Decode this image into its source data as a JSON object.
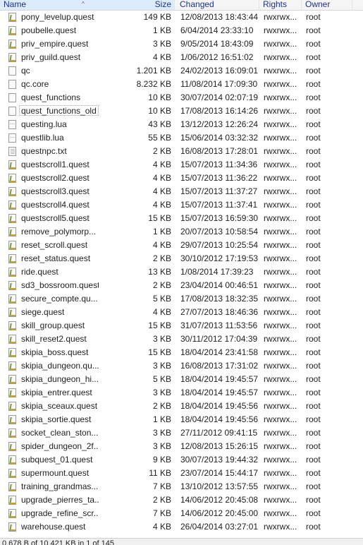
{
  "columns": {
    "name": "Name",
    "size": "Size",
    "changed": "Changed",
    "rights": "Rights",
    "owner": "Owner"
  },
  "files": [
    {
      "name": "pony_levelup.quest",
      "size": "149 KB",
      "changed": "12/08/2013 18:43:44",
      "rights": "rwxrwx...",
      "owner": "root",
      "icon": "quest"
    },
    {
      "name": "poubelle.quest",
      "size": "1 KB",
      "changed": "6/04/2014 23:33:10",
      "rights": "rwxrwx...",
      "owner": "root",
      "icon": "quest"
    },
    {
      "name": "priv_empire.quest",
      "size": "3 KB",
      "changed": "9/05/2014 18:43:09",
      "rights": "rwxrwx...",
      "owner": "root",
      "icon": "quest"
    },
    {
      "name": "priv_guild.quest",
      "size": "4 KB",
      "changed": "1/06/2012 16:51:02",
      "rights": "rwxrwx...",
      "owner": "root",
      "icon": "quest"
    },
    {
      "name": "qc",
      "size": "1.201 KB",
      "changed": "24/02/2013 16:09:01",
      "rights": "rwxrwx...",
      "owner": "root",
      "icon": "file"
    },
    {
      "name": "qc.core",
      "size": "8.232 KB",
      "changed": "11/08/2014 17:09:30",
      "rights": "rwxrwx...",
      "owner": "root",
      "icon": "file"
    },
    {
      "name": "quest_functions",
      "size": "10 KB",
      "changed": "30/07/2014 02:07:19",
      "rights": "rwxrwx...",
      "owner": "root",
      "icon": "file"
    },
    {
      "name": "quest_functions_old",
      "size": "10 KB",
      "changed": "17/08/2013 16:14:26",
      "rights": "rwxrwx...",
      "owner": "root",
      "icon": "file",
      "selected": true
    },
    {
      "name": "questing.lua",
      "size": "43 KB",
      "changed": "13/12/2013 12:26:24",
      "rights": "rwxrwx...",
      "owner": "root",
      "icon": "lua"
    },
    {
      "name": "questlib.lua",
      "size": "55 KB",
      "changed": "15/06/2014 03:32:32",
      "rights": "rwxrwx...",
      "owner": "root",
      "icon": "lua"
    },
    {
      "name": "questnpc.txt",
      "size": "2 KB",
      "changed": "16/08/2013 17:28:01",
      "rights": "rwxrwx...",
      "owner": "root",
      "icon": "txt"
    },
    {
      "name": "questscroll1.quest",
      "size": "4 KB",
      "changed": "15/07/2013 11:34:36",
      "rights": "rwxrwx...",
      "owner": "root",
      "icon": "quest"
    },
    {
      "name": "questscroll2.quest",
      "size": "4 KB",
      "changed": "15/07/2013 11:36:22",
      "rights": "rwxrwx...",
      "owner": "root",
      "icon": "quest"
    },
    {
      "name": "questscroll3.quest",
      "size": "4 KB",
      "changed": "15/07/2013 11:37:27",
      "rights": "rwxrwx...",
      "owner": "root",
      "icon": "quest"
    },
    {
      "name": "questscroll4.quest",
      "size": "4 KB",
      "changed": "15/07/2013 11:37:41",
      "rights": "rwxrwx...",
      "owner": "root",
      "icon": "quest"
    },
    {
      "name": "questscroll5.quest",
      "size": "15 KB",
      "changed": "15/07/2013 16:59:30",
      "rights": "rwxrwx...",
      "owner": "root",
      "icon": "quest"
    },
    {
      "name": "remove_polymorp...",
      "size": "1 KB",
      "changed": "20/07/2013 10:58:54",
      "rights": "rwxrwx...",
      "owner": "root",
      "icon": "quest"
    },
    {
      "name": "reset_scroll.quest",
      "size": "4 KB",
      "changed": "29/07/2013 10:25:54",
      "rights": "rwxrwx...",
      "owner": "root",
      "icon": "quest"
    },
    {
      "name": "reset_status.quest",
      "size": "2 KB",
      "changed": "30/10/2012 17:19:53",
      "rights": "rwxrwx...",
      "owner": "root",
      "icon": "quest"
    },
    {
      "name": "ride.quest",
      "size": "13 KB",
      "changed": "1/08/2014 17:39:23",
      "rights": "rwxrwx...",
      "owner": "root",
      "icon": "quest"
    },
    {
      "name": "sd3_bossroom.quest",
      "size": "2 KB",
      "changed": "23/04/2014 00:46:51",
      "rights": "rwxrwx...",
      "owner": "root",
      "icon": "quest"
    },
    {
      "name": "secure_compte.qu...",
      "size": "5 KB",
      "changed": "17/08/2013 18:32:35",
      "rights": "rwxrwx...",
      "owner": "root",
      "icon": "quest"
    },
    {
      "name": "siege.quest",
      "size": "4 KB",
      "changed": "27/07/2013 18:46:36",
      "rights": "rwxrwx...",
      "owner": "root",
      "icon": "quest"
    },
    {
      "name": "skill_group.quest",
      "size": "15 KB",
      "changed": "31/07/2013 11:53:56",
      "rights": "rwxrwx...",
      "owner": "root",
      "icon": "quest"
    },
    {
      "name": "skill_reset2.quest",
      "size": "3 KB",
      "changed": "30/11/2012 17:04:39",
      "rights": "rwxrwx...",
      "owner": "root",
      "icon": "quest"
    },
    {
      "name": "skipia_boss.quest",
      "size": "15 KB",
      "changed": "18/04/2014 23:41:58",
      "rights": "rwxrwx...",
      "owner": "root",
      "icon": "quest"
    },
    {
      "name": "skipia_dungeon.qu...",
      "size": "3 KB",
      "changed": "16/08/2013 17:31:02",
      "rights": "rwxrwx...",
      "owner": "root",
      "icon": "quest"
    },
    {
      "name": "skipia_dungeon_hi...",
      "size": "5 KB",
      "changed": "18/04/2014 19:45:57",
      "rights": "rwxrwx...",
      "owner": "root",
      "icon": "quest"
    },
    {
      "name": "skipia_entrer.quest",
      "size": "3 KB",
      "changed": "18/04/2014 19:45:57",
      "rights": "rwxrwx...",
      "owner": "root",
      "icon": "quest"
    },
    {
      "name": "skipia_sceaux.quest",
      "size": "2 KB",
      "changed": "18/04/2014 19:45:56",
      "rights": "rwxrwx...",
      "owner": "root",
      "icon": "quest"
    },
    {
      "name": "skipia_sortie.quest",
      "size": "1 KB",
      "changed": "18/04/2014 19:45:56",
      "rights": "rwxrwx...",
      "owner": "root",
      "icon": "quest"
    },
    {
      "name": "socket_clean_ston...",
      "size": "3 KB",
      "changed": "27/11/2012 09:41:15",
      "rights": "rwxrwx...",
      "owner": "root",
      "icon": "quest"
    },
    {
      "name": "spider_dungeon_2f...",
      "size": "3 KB",
      "changed": "12/08/2013 15:26:15",
      "rights": "rwxrwx...",
      "owner": "root",
      "icon": "quest"
    },
    {
      "name": "subquest_01.quest",
      "size": "9 KB",
      "changed": "30/07/2013 19:44:32",
      "rights": "rwxrwx...",
      "owner": "root",
      "icon": "quest"
    },
    {
      "name": "supermount.quest",
      "size": "11 KB",
      "changed": "23/07/2014 15:44:17",
      "rights": "rwxrwx...",
      "owner": "root",
      "icon": "quest"
    },
    {
      "name": "training_grandmas...",
      "size": "7 KB",
      "changed": "13/10/2012 13:57:55",
      "rights": "rwxrwx...",
      "owner": "root",
      "icon": "quest"
    },
    {
      "name": "upgrade_pierres_ta...",
      "size": "2 KB",
      "changed": "14/06/2012 20:45:08",
      "rights": "rwxrwx...",
      "owner": "root",
      "icon": "quest"
    },
    {
      "name": "upgrade_refine_scr...",
      "size": "7 KB",
      "changed": "14/06/2012 20:45:00",
      "rights": "rwxrwx...",
      "owner": "root",
      "icon": "quest"
    },
    {
      "name": "warehouse.quest",
      "size": "4 KB",
      "changed": "26/04/2014 03:27:01",
      "rights": "rwxrwx...",
      "owner": "root",
      "icon": "quest"
    }
  ],
  "status": "0,678 B of 10.421 KB in 1 of 145"
}
